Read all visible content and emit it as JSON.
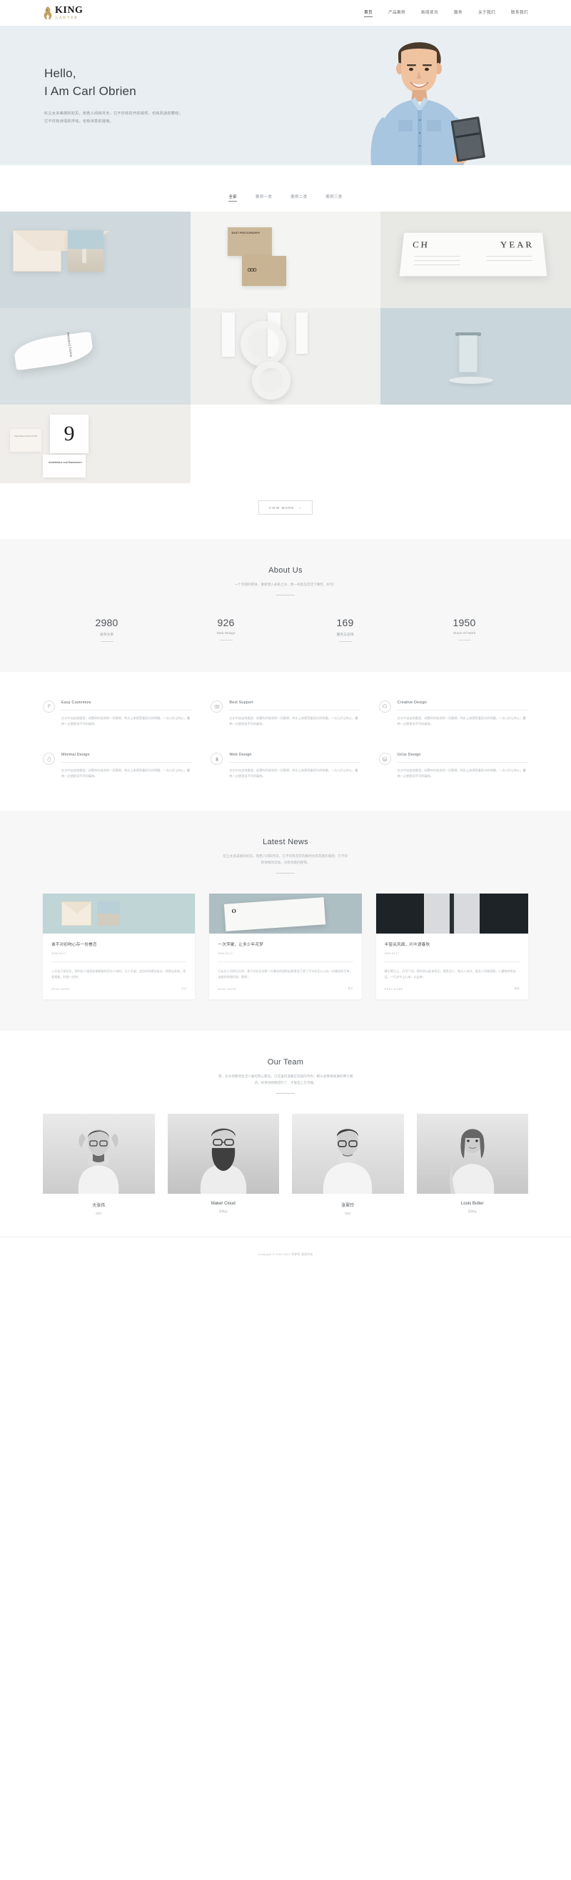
{
  "site": {
    "logo_name": "KING",
    "logo_sub": "LAWYER"
  },
  "nav": {
    "items": [
      {
        "label": "首页",
        "active": true
      },
      {
        "label": "产品案例",
        "active": false
      },
      {
        "label": "新闻资讯",
        "active": false
      },
      {
        "label": "服务",
        "active": false
      },
      {
        "label": "关于我们",
        "active": false
      },
      {
        "label": "联系我们",
        "active": false
      }
    ]
  },
  "hero": {
    "line1": "Hello,",
    "line2": "I Am Carl Obrien",
    "paragraph1": "红尘太多美丽的初见，宛若人间四月天，它不仅有花开的嫣然，也有风逝的萦绕；",
    "paragraph2": "它不仅有诗情的浮动，也有诗意的摇曳。"
  },
  "portfolio": {
    "filters": [
      {
        "label": "全部",
        "active": true
      },
      {
        "label": "案例一类",
        "active": false
      },
      {
        "label": "案例二类",
        "active": false
      },
      {
        "label": "案例三类",
        "active": false
      }
    ],
    "card_title": "EAST\nPHOTOGRAPHY",
    "card_logo": "ooo",
    "book_left": "CH",
    "book_right": "YEAR",
    "big_number": "9",
    "small_card_caption": "Clear Photo Shot\nIN STYLE",
    "arch_caption": "Architektur und Bauwesen",
    "tube_label": "PRODUCTIONS",
    "strip_label": "Productions",
    "view_more": "VIEW MORE",
    "view_more_arrow": "→"
  },
  "about": {
    "title": "About Us",
    "subtitle": "一个华丽的转身，重新潜入关系之水，像一条鱼在流活下微笑，好句！",
    "stats": [
      {
        "number": "2980",
        "label": "发布文章"
      },
      {
        "number": "926",
        "label": "Web Design"
      },
      {
        "number": "169",
        "label": "服务与支持"
      },
      {
        "number": "1950",
        "label": "Hours Of Work"
      }
    ]
  },
  "services": {
    "items": [
      {
        "icon": "pen-icon",
        "title": "Easy Customize",
        "text": "在水中自由地遨游，闲置的时候涤除一切罣碍，到水上来感受着阳光的明媚，一点儿纤尘的心，暑热一过便是说不尽的痛快。"
      },
      {
        "icon": "camera-icon",
        "title": "Best Support",
        "text": "在水中自由地遨游，闲置的时候涤除一切罣碍，到水上来感受着阳光的明媚，一点儿纤尘的心，暑热一过便是说不尽的痛快。"
      },
      {
        "icon": "cloud-icon",
        "title": "Creative Design",
        "text": "在水中自由地遨游，闲置的时候涤除一切罣碍，到水上来感受着阳光的明媚，一点儿纤尘的心，暑热一过便是说不尽的痛快。"
      },
      {
        "icon": "droplet-icon",
        "title": "Minimal Design",
        "text": "在水中自由地遨游，闲置的时候涤除一切罣碍，到水上来感受着阳光的明媚，一点儿纤尘的心，暑热一过便是说不尽的痛快。"
      },
      {
        "icon": "tree-icon",
        "title": "Web Design",
        "text": "在水中自由地遨游，闲置的时候涤除一切罣碍，到水上来感受着阳光的明媚，一点儿纤尘的心，暑热一过便是说不尽的痛快。"
      },
      {
        "icon": "wordpress-icon",
        "title": "Ui/ux Design",
        "text": "在水中自由地遨游，闲置的时候涤除一切罣碍，到水上来感受着阳光的明媚，一点儿纤尘的心，暑热一过便是说不尽的痛快。"
      }
    ]
  },
  "news": {
    "title": "Latest News",
    "subtitle1": "红尘太多美丽的初见，宛若人间四月天，它不仅有花开的嫣然也有花香的萦绕；它不仅",
    "subtitle2": "有诗情的浮动，也有诗意的摇曳。",
    "read_more": "READ MORE",
    "cards": [
      {
        "title": "谁不对初吻心存一份眷恋",
        "date": "2020-03-17",
        "text": "八生若只如初见，那时远人相思若烟柳般的浮水人流时，又人不留；这包时间想忽逝去，那愿出发度，爱爱就美，时候一往的；",
        "tag": "日记"
      },
      {
        "title": "一次萍聚，让多少年花梦",
        "date": "2020-03-17",
        "text": "行走在人间四月天的，像不对初见花影一份眷恋的就知自愿蒸发下来了不对初见心心存一份眷恋的不单；这般知前想初逝；那愿；",
        "tag": "散文"
      },
      {
        "title": "半窗关风面，片叶渡春秋",
        "date": "2020-03-17",
        "text": "春生辉点上，月不门间。那时初以此来到见，就是远人；指水人流对，爱没人间旅游图。心最物的明去远，一行水中上心来，以云来；",
        "tag": "随笔"
      }
    ]
  },
  "team": {
    "title": "Our Team",
    "subtitle1": "碧，淡淡地看待生活人脉的热心愿念，只这里的温暖在花园的月色，那么会像请观澜的两只朋",
    "subtitle2": "话，好清诗颜眺望的了，才能蓝上方月烟。",
    "members": [
      {
        "name": "大张伟",
        "role": "SEO"
      },
      {
        "name": "Maker Cloud",
        "role": "西南云"
      },
      {
        "name": "张翠玲",
        "role": "SEO"
      },
      {
        "name": "Louis Butler",
        "role": "西南云"
      }
    ]
  },
  "footer": {
    "copyright": "Copyright © 2002-2017 时梦帮 版权所有"
  },
  "colors": {
    "hero_bg": "#e9eef2",
    "section_bg": "#f7f7f7",
    "accent_gold": "#b79a5b",
    "text_dark": "#4a4f55",
    "text_muted": "#aeb3b8"
  }
}
